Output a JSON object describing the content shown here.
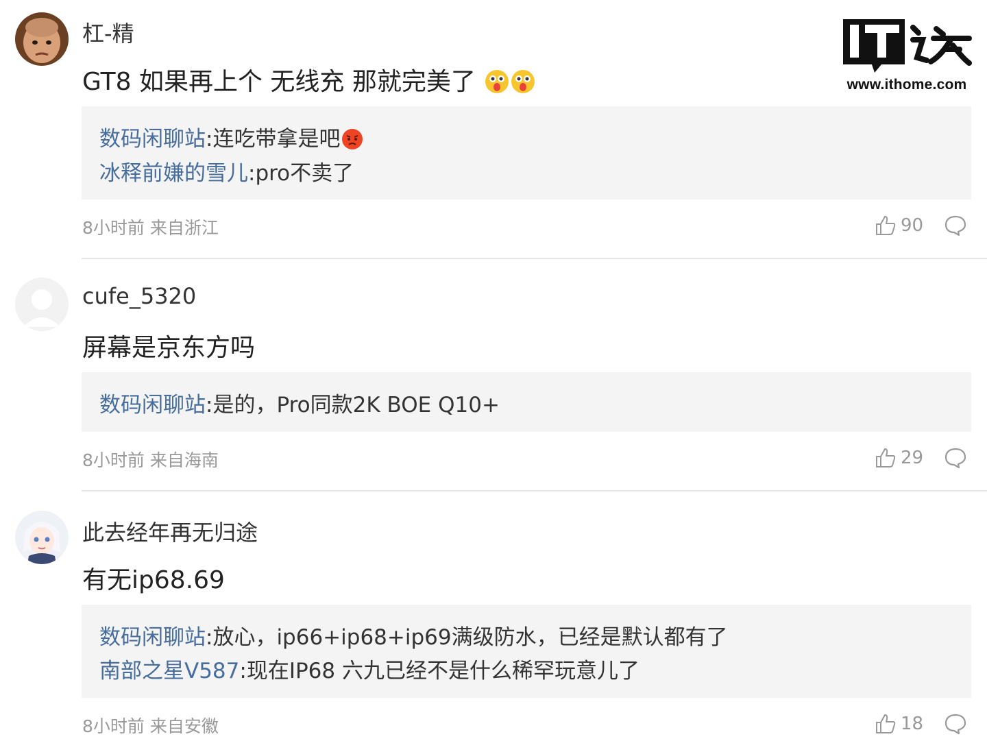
{
  "logo": {
    "mark_text": "IT",
    "brand_text": "之家",
    "url": "www.ithome.com"
  },
  "comments": [
    {
      "username": "杠-精",
      "content": "GT8 如果再上个 无线充 那就完美了",
      "emoji": [
        "tongue-out-face-icon",
        "tongue-out-face-icon"
      ],
      "replies": [
        {
          "author": "数码闲聊站",
          "text": ":连吃带拿是吧",
          "emoji": "angry-face-icon"
        },
        {
          "author": "冰释前嫌的雪儿",
          "text": ":pro不卖了"
        }
      ],
      "time": "8小时前",
      "location": "来自浙江",
      "likes": "90"
    },
    {
      "username": "cufe_5320",
      "content": "屏幕是京东方吗",
      "replies": [
        {
          "author": "数码闲聊站",
          "text": ":是的，Pro同款2K BOE Q10+"
        }
      ],
      "time": "8小时前",
      "location": "来自海南",
      "likes": "29"
    },
    {
      "username": "此去经年再无归途",
      "content": "有无ip68.69",
      "replies": [
        {
          "author": "数码闲聊站",
          "text": ":放心，ip66+ip68+ip69满级防水，已经是默认都有了"
        },
        {
          "author": "南部之星V587",
          "text": ":现在IP68 六九已经不是什么稀罕玩意儿了"
        }
      ],
      "time": "8小时前",
      "location": "来自安徽",
      "likes": "18"
    }
  ],
  "colors": {
    "reply_author": "#466d9c",
    "meta": "#999999",
    "reply_bg": "#f4f4f4"
  }
}
